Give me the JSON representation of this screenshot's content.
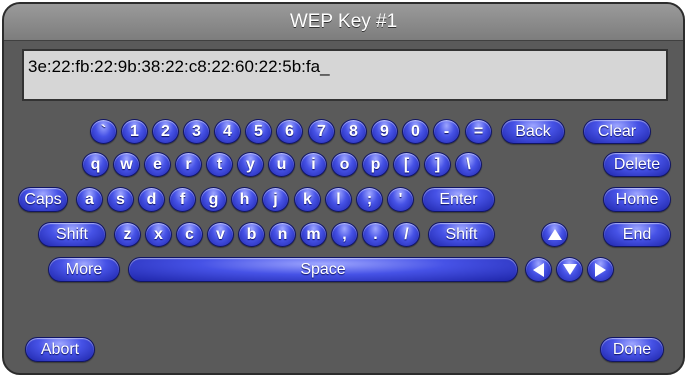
{
  "title": "WEP Key #1",
  "input_value": "3e:22:fb:22:9b:38:22:c8:22:60:22:5b:fa_",
  "rows": {
    "row1": [
      "`",
      "1",
      "2",
      "3",
      "4",
      "5",
      "6",
      "7",
      "8",
      "9",
      "0",
      "-",
      "="
    ],
    "row2": [
      "q",
      "w",
      "e",
      "r",
      "t",
      "y",
      "u",
      "i",
      "o",
      "p",
      "[",
      "]",
      "\\"
    ],
    "row3": [
      "a",
      "s",
      "d",
      "f",
      "g",
      "h",
      "j",
      "k",
      "l",
      ";",
      "'"
    ],
    "row4": [
      "z",
      "x",
      "c",
      "v",
      "b",
      "n",
      "m",
      ",",
      ".",
      "/"
    ]
  },
  "keys": {
    "back": "Back",
    "clear": "Clear",
    "delete": "Delete",
    "caps": "Caps",
    "enter": "Enter",
    "home": "Home",
    "shift_left": "Shift",
    "shift_right": "Shift",
    "end": "End",
    "more": "More",
    "space": "Space",
    "abort": "Abort",
    "done": "Done"
  },
  "arrow_icons": [
    "up-arrow-icon",
    "left-arrow-icon",
    "down-arrow-icon",
    "right-arrow-icon"
  ],
  "colors": {
    "panel_bg": "#5a5a5a",
    "key_blue": "#3a45d8",
    "field_bg": "#d6d6d6",
    "title_bar": "#8a8a8a"
  }
}
